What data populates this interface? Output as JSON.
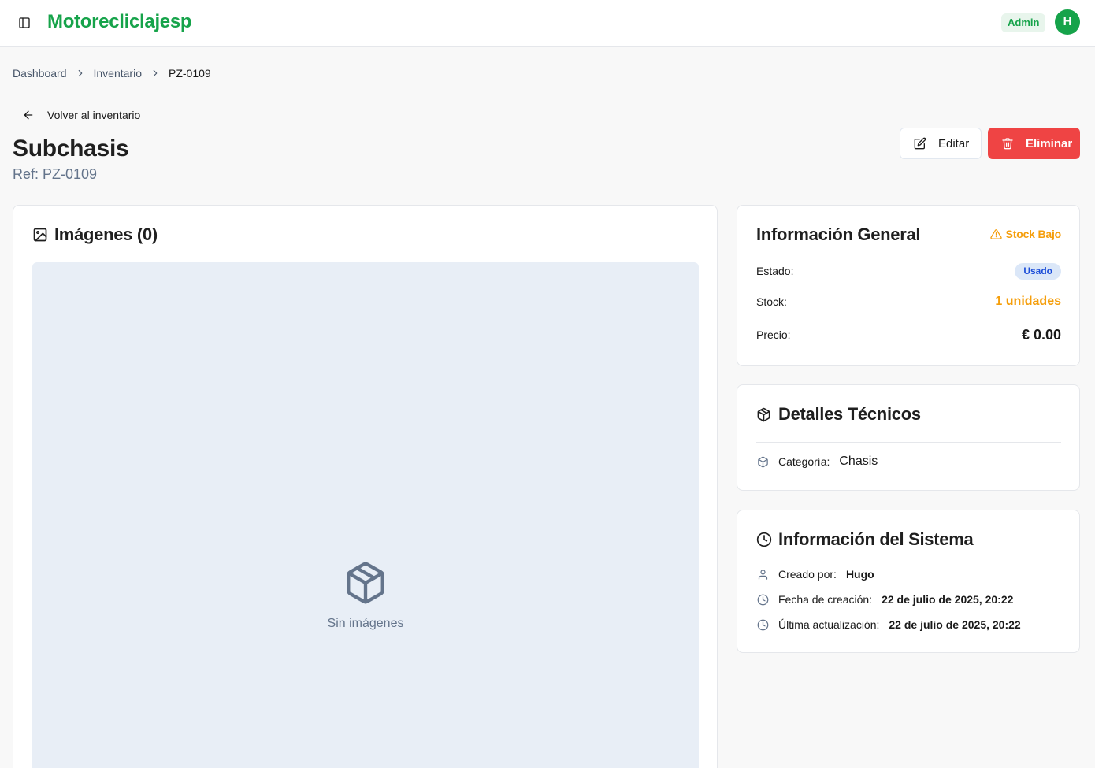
{
  "header": {
    "brand": "Motorecliclajesp",
    "role_badge": "Admin",
    "avatar_initial": "H"
  },
  "breadcrumb": {
    "items": [
      "Dashboard",
      "Inventario"
    ],
    "current": "PZ-0109"
  },
  "back_link": "Volver al inventario",
  "page": {
    "title": "Subchasis",
    "subtitle": "Ref: PZ-0109"
  },
  "actions": {
    "edit_label": "Editar",
    "delete_label": "Eliminar"
  },
  "images": {
    "title": "Imágenes (0)",
    "empty_text": "Sin imágenes"
  },
  "general": {
    "title": "Información General",
    "stock_alert": "Stock Bajo",
    "estado_label": "Estado:",
    "estado_value": "Usado",
    "stock_label": "Stock:",
    "stock_value": "1 unidades",
    "precio_label": "Precio:",
    "precio_value": "€ 0.00"
  },
  "technical": {
    "title": "Detalles Técnicos",
    "categoria_label": "Categoría:",
    "categoria_value": "Chasis"
  },
  "system": {
    "title": "Información del Sistema",
    "creado_label": "Creado por:",
    "creado_value": "Hugo",
    "fecha_label": "Fecha de creación:",
    "fecha_value": "22 de julio de 2025, 20:22",
    "actualizacion_label": "Última actualización:",
    "actualizacion_value": "22 de julio de 2025, 20:22"
  },
  "colors": {
    "brand": "#16a34a",
    "danger": "#ef4444",
    "warning": "#f59e0b",
    "info": "#1d4ed8"
  },
  "icons": {
    "sidebar_toggle": "panel-left-icon",
    "back": "arrow-left-icon",
    "edit": "edit-icon",
    "delete": "trash-icon",
    "images": "image-icon",
    "empty": "package-icon",
    "alert": "warning-triangle-icon",
    "technical": "package-icon",
    "system": "clock-icon",
    "user": "user-icon"
  }
}
